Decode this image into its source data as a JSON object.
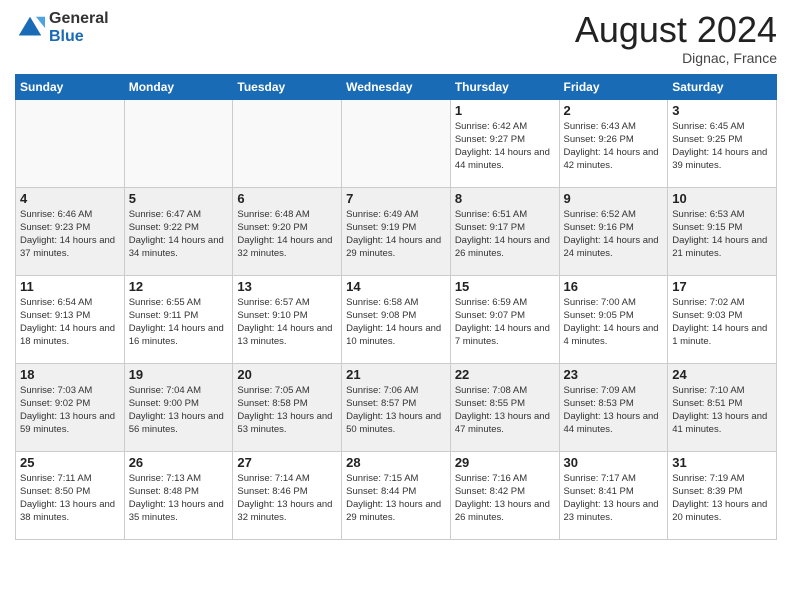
{
  "header": {
    "logo_general": "General",
    "logo_blue": "Blue",
    "month_title": "August 2024",
    "subtitle": "Dignac, France"
  },
  "days_of_week": [
    "Sunday",
    "Monday",
    "Tuesday",
    "Wednesday",
    "Thursday",
    "Friday",
    "Saturday"
  ],
  "weeks": [
    [
      {
        "day": "",
        "empty": true
      },
      {
        "day": "",
        "empty": true
      },
      {
        "day": "",
        "empty": true
      },
      {
        "day": "",
        "empty": true
      },
      {
        "day": "1",
        "sunrise": "6:42 AM",
        "sunset": "9:27 PM",
        "daylight": "14 hours and 44 minutes."
      },
      {
        "day": "2",
        "sunrise": "6:43 AM",
        "sunset": "9:26 PM",
        "daylight": "14 hours and 42 minutes."
      },
      {
        "day": "3",
        "sunrise": "6:45 AM",
        "sunset": "9:25 PM",
        "daylight": "14 hours and 39 minutes."
      }
    ],
    [
      {
        "day": "4",
        "sunrise": "6:46 AM",
        "sunset": "9:23 PM",
        "daylight": "14 hours and 37 minutes."
      },
      {
        "day": "5",
        "sunrise": "6:47 AM",
        "sunset": "9:22 PM",
        "daylight": "14 hours and 34 minutes."
      },
      {
        "day": "6",
        "sunrise": "6:48 AM",
        "sunset": "9:20 PM",
        "daylight": "14 hours and 32 minutes."
      },
      {
        "day": "7",
        "sunrise": "6:49 AM",
        "sunset": "9:19 PM",
        "daylight": "14 hours and 29 minutes."
      },
      {
        "day": "8",
        "sunrise": "6:51 AM",
        "sunset": "9:17 PM",
        "daylight": "14 hours and 26 minutes."
      },
      {
        "day": "9",
        "sunrise": "6:52 AM",
        "sunset": "9:16 PM",
        "daylight": "14 hours and 24 minutes."
      },
      {
        "day": "10",
        "sunrise": "6:53 AM",
        "sunset": "9:15 PM",
        "daylight": "14 hours and 21 minutes."
      }
    ],
    [
      {
        "day": "11",
        "sunrise": "6:54 AM",
        "sunset": "9:13 PM",
        "daylight": "14 hours and 18 minutes."
      },
      {
        "day": "12",
        "sunrise": "6:55 AM",
        "sunset": "9:11 PM",
        "daylight": "14 hours and 16 minutes."
      },
      {
        "day": "13",
        "sunrise": "6:57 AM",
        "sunset": "9:10 PM",
        "daylight": "14 hours and 13 minutes."
      },
      {
        "day": "14",
        "sunrise": "6:58 AM",
        "sunset": "9:08 PM",
        "daylight": "14 hours and 10 minutes."
      },
      {
        "day": "15",
        "sunrise": "6:59 AM",
        "sunset": "9:07 PM",
        "daylight": "14 hours and 7 minutes."
      },
      {
        "day": "16",
        "sunrise": "7:00 AM",
        "sunset": "9:05 PM",
        "daylight": "14 hours and 4 minutes."
      },
      {
        "day": "17",
        "sunrise": "7:02 AM",
        "sunset": "9:03 PM",
        "daylight": "14 hours and 1 minute."
      }
    ],
    [
      {
        "day": "18",
        "sunrise": "7:03 AM",
        "sunset": "9:02 PM",
        "daylight": "13 hours and 59 minutes."
      },
      {
        "day": "19",
        "sunrise": "7:04 AM",
        "sunset": "9:00 PM",
        "daylight": "13 hours and 56 minutes."
      },
      {
        "day": "20",
        "sunrise": "7:05 AM",
        "sunset": "8:58 PM",
        "daylight": "13 hours and 53 minutes."
      },
      {
        "day": "21",
        "sunrise": "7:06 AM",
        "sunset": "8:57 PM",
        "daylight": "13 hours and 50 minutes."
      },
      {
        "day": "22",
        "sunrise": "7:08 AM",
        "sunset": "8:55 PM",
        "daylight": "13 hours and 47 minutes."
      },
      {
        "day": "23",
        "sunrise": "7:09 AM",
        "sunset": "8:53 PM",
        "daylight": "13 hours and 44 minutes."
      },
      {
        "day": "24",
        "sunrise": "7:10 AM",
        "sunset": "8:51 PM",
        "daylight": "13 hours and 41 minutes."
      }
    ],
    [
      {
        "day": "25",
        "sunrise": "7:11 AM",
        "sunset": "8:50 PM",
        "daylight": "13 hours and 38 minutes."
      },
      {
        "day": "26",
        "sunrise": "7:13 AM",
        "sunset": "8:48 PM",
        "daylight": "13 hours and 35 minutes."
      },
      {
        "day": "27",
        "sunrise": "7:14 AM",
        "sunset": "8:46 PM",
        "daylight": "13 hours and 32 minutes."
      },
      {
        "day": "28",
        "sunrise": "7:15 AM",
        "sunset": "8:44 PM",
        "daylight": "13 hours and 29 minutes."
      },
      {
        "day": "29",
        "sunrise": "7:16 AM",
        "sunset": "8:42 PM",
        "daylight": "13 hours and 26 minutes."
      },
      {
        "day": "30",
        "sunrise": "7:17 AM",
        "sunset": "8:41 PM",
        "daylight": "13 hours and 23 minutes."
      },
      {
        "day": "31",
        "sunrise": "7:19 AM",
        "sunset": "8:39 PM",
        "daylight": "13 hours and 20 minutes."
      }
    ]
  ]
}
